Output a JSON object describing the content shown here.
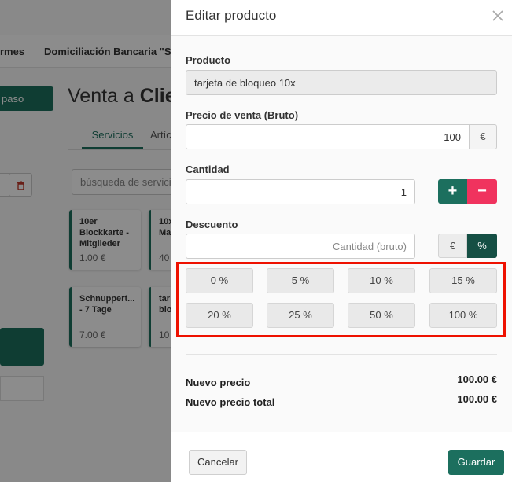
{
  "background": {
    "menu_items": [
      "rmes",
      "Domiciliación Bancaria \"SEPA"
    ],
    "green_button_label": "paso",
    "title_plain": "Venta a ",
    "title_bold": "Clier",
    "tabs": [
      "Servicios",
      "Artíc"
    ],
    "search_placeholder": "búsqueda de servici",
    "delete_icon": "trash-icon",
    "cards": [
      {
        "name": "10er\nBlockkarte -\nMitglieder",
        "price": "1.00 €"
      },
      {
        "name": "10x\nMa",
        "price": "40"
      },
      {
        "name": "Schnuppert...\n- 7 Tage",
        "price": "7.00 €"
      },
      {
        "name": "tar\nblo",
        "price": "10"
      }
    ]
  },
  "modal": {
    "title": "Editar producto",
    "close_icon": "close-icon",
    "product": {
      "label": "Producto",
      "value": "tarjeta de bloqueo 10x"
    },
    "price": {
      "label": "Precio de venta (Bruto)",
      "value": "100",
      "currency": "€"
    },
    "quantity": {
      "label": "Cantidad",
      "value": "1",
      "plus": "+",
      "minus": "−"
    },
    "discount": {
      "label": "Descuento",
      "placeholder": "Cantidad (bruto)",
      "mode_eur": "€",
      "mode_pct": "%",
      "active_mode": "%",
      "percent_options": [
        "0 %",
        "5 %",
        "10 %",
        "15 %",
        "20 %",
        "25 %",
        "50 %",
        "100 %"
      ]
    },
    "summary": {
      "new_price_label": "Nuevo precio",
      "new_price_value": "100.00 €",
      "new_total_label": "Nuevo precio total",
      "new_total_value": "100.00 €"
    },
    "footer": {
      "cancel": "Cancelar",
      "save": "Guardar"
    }
  },
  "colors": {
    "primary": "#1c6f5e",
    "primary_dark": "#154f44",
    "danger": "#f0335e",
    "highlight": "#ee1100"
  }
}
